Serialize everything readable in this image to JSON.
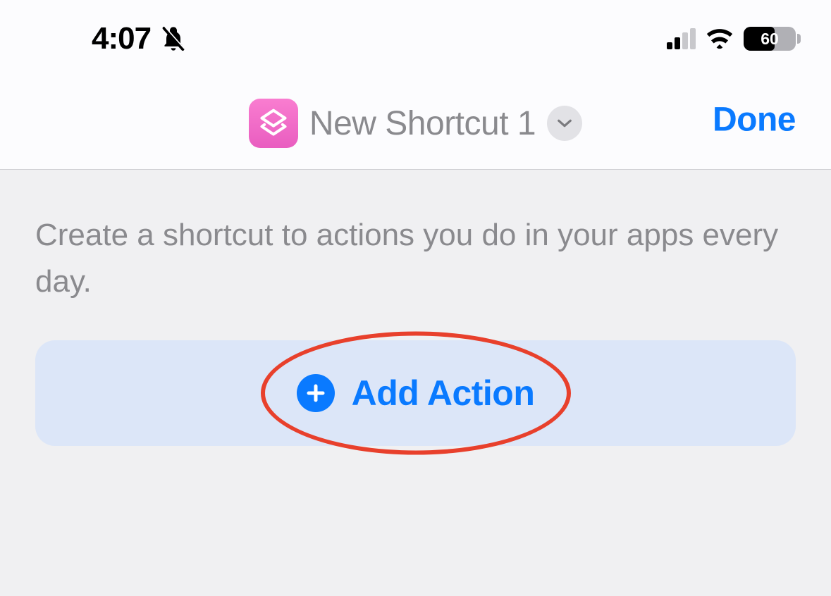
{
  "status_bar": {
    "time": "4:07",
    "silent_mode": true,
    "cellular_bars": 2,
    "cellular_total_bars": 4,
    "wifi_connected": true,
    "battery_percent": "60"
  },
  "nav": {
    "title": "New Shortcut 1",
    "done_label": "Done",
    "icon": "shortcuts-app-icon"
  },
  "main": {
    "hint_text": "Create a shortcut to actions you do in your apps every day.",
    "add_action_label": "Add Action"
  },
  "annotation": {
    "has_red_ellipse": true,
    "color": "#e8402c"
  },
  "colors": {
    "accent": "#0a7aff",
    "shortcut_icon": "#ef6cc7",
    "add_action_bg": "#dce6f8",
    "gray_text": "#8a8a8e"
  }
}
